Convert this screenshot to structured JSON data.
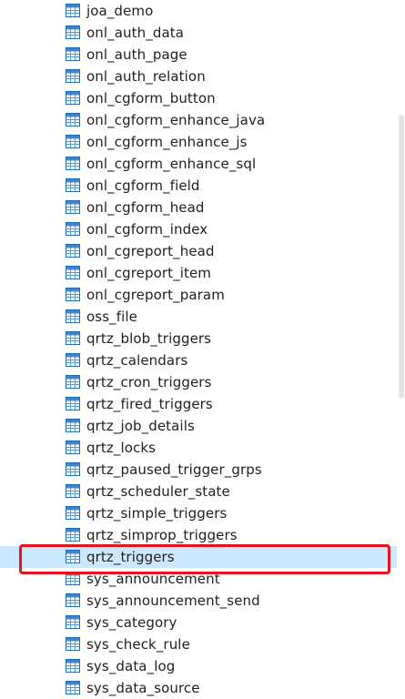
{
  "icon_name": "table-icon",
  "icon_colors": {
    "border": "#1a6fb8",
    "header": "#3b8bd0",
    "fill": "#ffffff",
    "grid": "#5b9bd5"
  },
  "selected_color": "#cce8ff",
  "highlight_color": "#e3151c",
  "tables": [
    "joa_demo",
    "onl_auth_data",
    "onl_auth_page",
    "onl_auth_relation",
    "onl_cgform_button",
    "onl_cgform_enhance_java",
    "onl_cgform_enhance_js",
    "onl_cgform_enhance_sql",
    "onl_cgform_field",
    "onl_cgform_head",
    "onl_cgform_index",
    "onl_cgreport_head",
    "onl_cgreport_item",
    "onl_cgreport_param",
    "oss_file",
    "qrtz_blob_triggers",
    "qrtz_calendars",
    "qrtz_cron_triggers",
    "qrtz_fired_triggers",
    "qrtz_job_details",
    "qrtz_locks",
    "qrtz_paused_trigger_grps",
    "qrtz_scheduler_state",
    "qrtz_simple_triggers",
    "qrtz_simprop_triggers",
    "qrtz_triggers",
    "sys_announcement",
    "sys_announcement_send",
    "sys_category",
    "sys_check_rule",
    "sys_data_log",
    "sys_data_source"
  ],
  "selected_table": "qrtz_triggers"
}
